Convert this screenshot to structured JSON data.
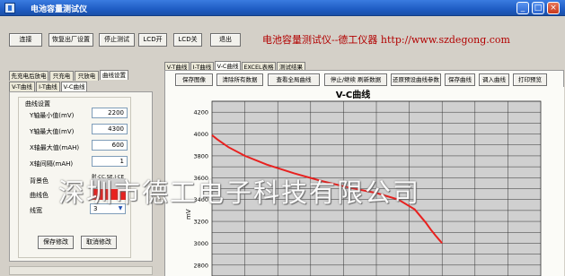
{
  "window": {
    "title": "电池容量测试仪",
    "controls": [
      "_",
      "□",
      "×"
    ]
  },
  "toolbar": {
    "buttons": [
      "连接",
      "恢复出厂设置",
      "停止测试",
      "LCD开",
      "LCD关",
      "退出"
    ]
  },
  "brand": "电池容量测试仪--德工仪器 http://www.szdegong.com",
  "left_tabs": {
    "outer": [
      "先充电后放电",
      "只充电",
      "只放电",
      "曲线设置"
    ],
    "outer_active": 3,
    "inner": [
      "V-T曲线",
      "I-T曲线",
      "V-C曲线"
    ],
    "inner_active": 2
  },
  "settings": {
    "group_title": "曲线设置",
    "fields": [
      {
        "label": "Y轴最小值(mV)",
        "value": "2200"
      },
      {
        "label": "Y轴最大值(mV)",
        "value": "4300"
      },
      {
        "label": "X轴最大值(mAH)",
        "value": "600"
      },
      {
        "label": "X轴间隔(mAH)",
        "value": "1"
      }
    ],
    "bg_color_label": "背景色",
    "bg_color_small": "射·CC.SE.J·CE",
    "curve_color_label": "曲线色",
    "line_width_label": "线宽",
    "line_width_value": "3",
    "save_button": "保存修改",
    "cancel_button": "取消修改"
  },
  "right_tabs": {
    "items": [
      "V-T曲线",
      "I-T曲线",
      "V-C曲线",
      "EXCEL表格",
      "测试结果"
    ],
    "active": 2
  },
  "actions": [
    "保存图像",
    "清除所有数据",
    "查看全局曲线",
    "停止/继续 刷新数据",
    "还原预设曲线参数",
    "保存曲线",
    "调入曲线",
    "打印预览"
  ],
  "colors": {
    "curve": "#e8211f",
    "plot_bg": "#d0d0d0",
    "brand": "#b20000",
    "titlebar": "#2361cc"
  },
  "watermark": "深圳市德工电子科技有限公司",
  "chart_data": {
    "type": "line",
    "title": "V-C曲线",
    "ylabel": "mV",
    "ylim": [
      2700,
      4300
    ],
    "xlim": [
      0,
      600
    ],
    "yticks": [
      2800,
      3000,
      3200,
      3400,
      3600,
      3800,
      4000,
      4200
    ],
    "grid": true,
    "series": [
      {
        "x": [
          0,
          10,
          30,
          60,
          100,
          150,
          200,
          250,
          300,
          340,
          370,
          390,
          400,
          408,
          415,
          420
        ],
        "y": [
          3990,
          3950,
          3880,
          3800,
          3720,
          3640,
          3570,
          3510,
          3460,
          3400,
          3310,
          3190,
          3120,
          3070,
          3030,
          3000
        ]
      }
    ]
  }
}
